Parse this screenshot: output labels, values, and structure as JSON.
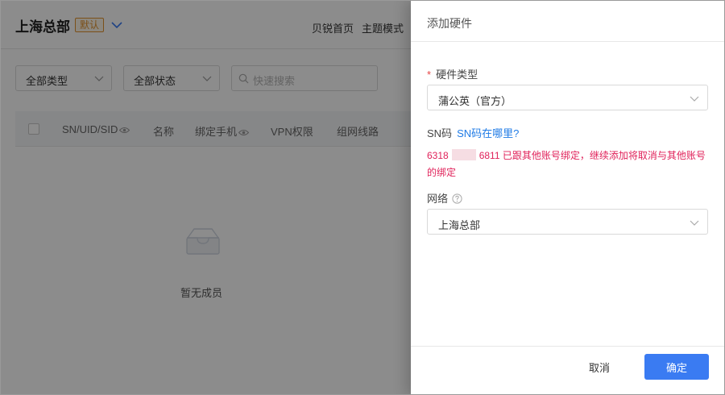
{
  "background": {
    "org_name": "上海总部",
    "default_badge": "默认",
    "nav": [
      "贝锐首页",
      "主题模式"
    ],
    "filters": {
      "type": "全部类型",
      "status": "全部状态",
      "search_placeholder": "快速搜索"
    },
    "table_columns": [
      "SN/UID/SID",
      "名称",
      "绑定手机",
      "VPN权限",
      "组网线路"
    ],
    "empty_text": "暂无成员"
  },
  "drawer": {
    "title": "添加硬件",
    "hardware_type": {
      "required_mark": "*",
      "label": "硬件类型",
      "value": "蒲公英（官方）"
    },
    "sn": {
      "label": "SN码",
      "help_link": "SN码在哪里?"
    },
    "error": {
      "sn_prefix": "6318",
      "sn_suffix": "6811",
      "message": "已跟其他账号绑定，继续添加将取消与其他账号的绑定"
    },
    "network": {
      "label": "网络",
      "value": "上海总部"
    },
    "footer": {
      "cancel": "取消",
      "confirm": "确定"
    }
  },
  "colors": {
    "primary": "#3a7bf2",
    "link": "#1f7be6",
    "error": "#e0225a",
    "badge": "#e0922f",
    "mask": "rgba(0,0,0,0.45)"
  },
  "icons": [
    "chevron-down-icon",
    "search-icon",
    "eye-icon",
    "empty-box-icon",
    "question-circle-icon"
  ]
}
